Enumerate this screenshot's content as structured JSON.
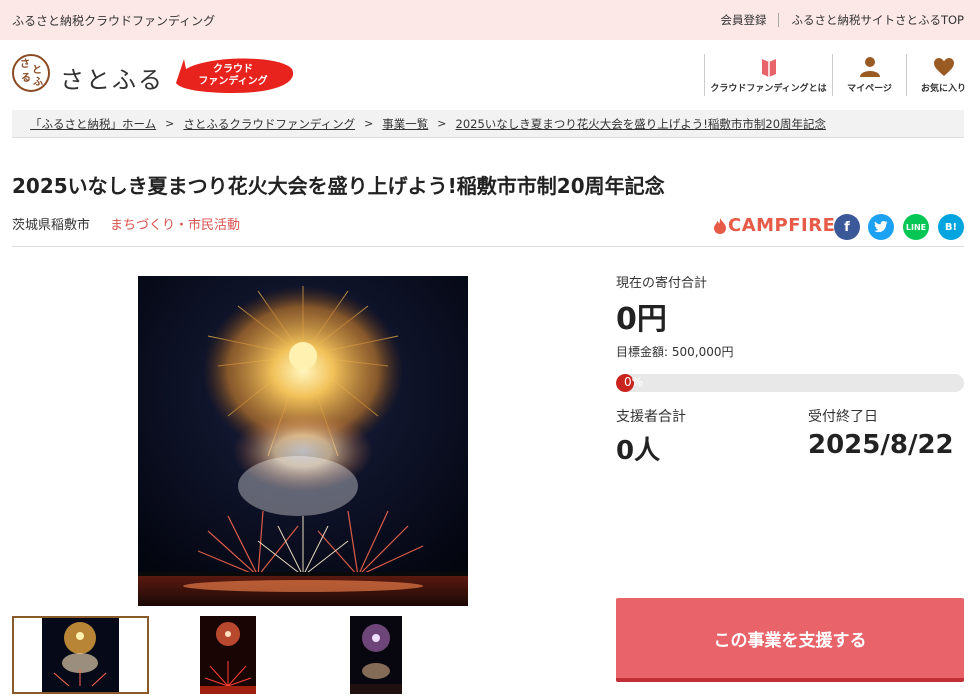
{
  "topbar": {
    "tagline": "ふるさと納税クラウドファンディング",
    "links": [
      "会員登録",
      "ふるさと納税サイトさとふるTOP"
    ]
  },
  "header": {
    "logo_text": "さとふる",
    "logo_mark_chars": [
      "さ",
      "と",
      "ふ",
      "る"
    ],
    "badge_lines": [
      "クラウド",
      "ファンディング"
    ],
    "nav": [
      {
        "label": "クラウドファンディングとは",
        "icon": "book-icon"
      },
      {
        "label": "マイページ",
        "icon": "user-icon"
      },
      {
        "label": "お気に入り",
        "icon": "heart-icon"
      }
    ]
  },
  "breadcrumb": [
    "「ふるさと納税」ホーム",
    "さとふるクラウドファンディング",
    "事業一覧",
    "2025いなしき夏まつり花火大会を盛り上げよう!稲敷市市制20周年記念"
  ],
  "breadcrumb_separator": ">",
  "project": {
    "title": "2025いなしき夏まつり花火大会を盛り上げよう!稲敷市市制20周年記念",
    "location": "茨城県稲敷市",
    "category": "まちづくり・市民活動",
    "platform": "CAMPFIRE"
  },
  "share": {
    "facebook": "f",
    "twitter": "t",
    "line": "LINE",
    "hatena": "B!"
  },
  "stats": {
    "total_label": "現在の寄付合計",
    "total_value": "0円",
    "goal_text": "目標金額: 500,000円",
    "progress_text": "0%",
    "progress_fraction": 0,
    "supporters_label": "支援者合計",
    "supporters_value": "0人",
    "deadline_label": "受付終了日",
    "deadline_value": "2025/8/22"
  },
  "support_button": "この事業を支援する",
  "colors": {
    "topbar_bg": "#fde8e8",
    "accent_red": "#e8636a",
    "category_red": "#d9534f",
    "campfire": "#e65a47",
    "brand_brown": "#8a4a22"
  }
}
